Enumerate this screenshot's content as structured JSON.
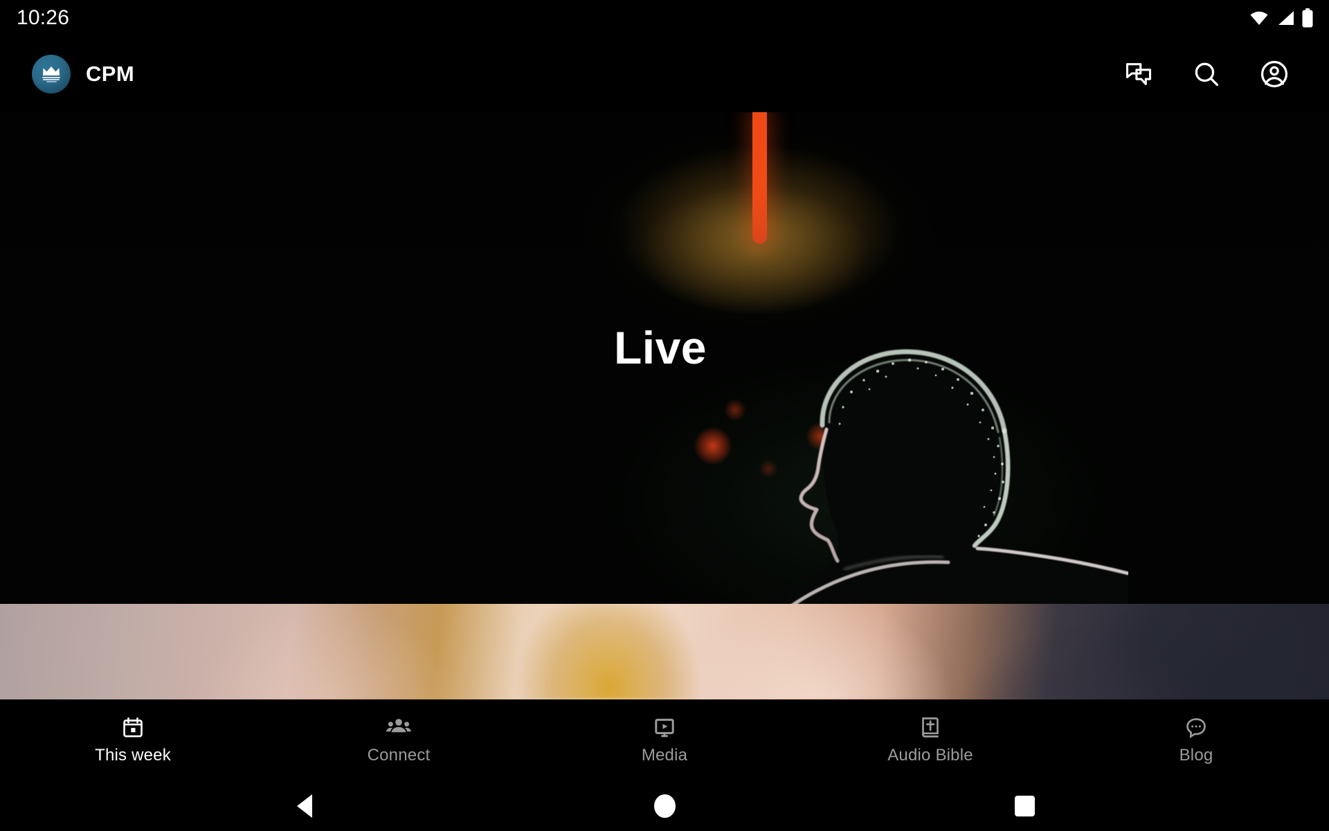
{
  "status_bar": {
    "time": "10:26",
    "icons": [
      "wifi-icon",
      "cellular-signal-icon",
      "battery-full-icon"
    ]
  },
  "header": {
    "logo_icon": "crown-logo-icon",
    "title": "CPM",
    "actions": [
      {
        "name": "messages-icon",
        "label": "Messages"
      },
      {
        "name": "search-icon",
        "label": "Search"
      },
      {
        "name": "account-icon",
        "label": "Account"
      }
    ]
  },
  "feed": {
    "cards": [
      {
        "title": "Live",
        "accent_color": "#ef4a16",
        "background_color": "#020302",
        "description": "Dark stage photo: rim-lit silhouette of a person in profile with orange stage light bar and amber bokeh lights"
      },
      {
        "title": "",
        "background_color": "#d6b8ad",
        "description": "Blurred close-up of hands in warm skin and cream tones with gold center and dark slate right edge"
      }
    ]
  },
  "bottom_nav": {
    "active_index": 0,
    "tabs": [
      {
        "label": "This week",
        "icon": "calendar-icon",
        "active": true
      },
      {
        "label": "Connect",
        "icon": "people-group-icon",
        "active": false
      },
      {
        "label": "Media",
        "icon": "video-monitor-icon",
        "active": false
      },
      {
        "label": "Audio Bible",
        "icon": "bible-book-icon",
        "active": false
      },
      {
        "label": "Blog",
        "icon": "comment-dots-icon",
        "active": false
      }
    ],
    "active_color": "#ffffff",
    "inactive_color": "#9b9b9b"
  },
  "android_nav": {
    "buttons": [
      {
        "name": "back-button",
        "icon": "triangle-back-icon"
      },
      {
        "name": "home-button",
        "icon": "circle-home-icon"
      },
      {
        "name": "recents-button",
        "icon": "square-recents-icon"
      }
    ]
  }
}
